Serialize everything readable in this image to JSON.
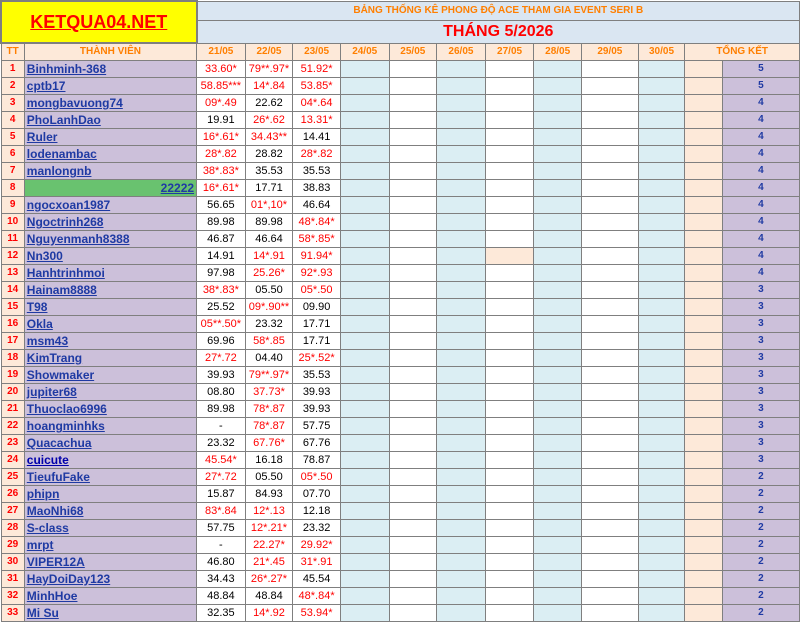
{
  "logo": "KETQUA04.NET",
  "title": "BẢNG THỐNG KÊ PHONG ĐỘ ACE THAM GIA EVENT SERI B",
  "month": "THÁNG 5/2026",
  "headers": {
    "tt": "TT",
    "member": "THÀNH VIÊN",
    "dates": [
      "21/05",
      "22/05",
      "23/05",
      "24/05",
      "25/05",
      "26/05",
      "27/05",
      "28/05",
      "29/05",
      "30/05"
    ],
    "total": "TỔNG KẾT"
  },
  "rows": [
    {
      "tt": "1",
      "name": "Binhminh-368",
      "d21": "33.60*",
      "d22": "79**.97*",
      "d23": "51.92*",
      "total": "5"
    },
    {
      "tt": "2",
      "name": "cptb17",
      "d21": "58.85***",
      "d22": "14*.84",
      "d23": "53.85*",
      "total": "5"
    },
    {
      "tt": "3",
      "name": "mongbavuong74",
      "d21": "09*.49",
      "d22": "22.62",
      "d23": "04*.64",
      "total": "4"
    },
    {
      "tt": "4",
      "name": "PhoLanhDao",
      "d21": "19.91",
      "d22": "26*.62",
      "d23": "13.31*",
      "total": "4"
    },
    {
      "tt": "5",
      "name": "Ruler",
      "d21": "16*.61*",
      "d22": "34.43**",
      "d23": "14.41",
      "total": "4"
    },
    {
      "tt": "6",
      "name": "lodenambac",
      "d21": "28*.82",
      "d22": "28.82",
      "d23": "28*.82",
      "total": "4"
    },
    {
      "tt": "7",
      "name": "manlongnb",
      "d21": "38*.83*",
      "d22": "35.53",
      "d23": "35.53",
      "total": "4"
    },
    {
      "tt": "8",
      "name": "22222",
      "d21": "16*.61*",
      "d22": "17.71",
      "d23": "38.83",
      "total": "4"
    },
    {
      "tt": "9",
      "name": "ngocxoan1987",
      "d21": "56.65",
      "d22": "01*,10*",
      "d23": "46.64",
      "total": "4"
    },
    {
      "tt": "10",
      "name": "Ngoctrinh268",
      "d21": "89.98",
      "d22": "89.98",
      "d23": "48*.84*",
      "total": "4"
    },
    {
      "tt": "11",
      "name": "Nguyenmanh8388",
      "d21": "46.87",
      "d22": "46.64",
      "d23": "58*.85*",
      "total": "4"
    },
    {
      "tt": "12",
      "name": "Nn300",
      "d21": "14.91",
      "d22": "14*.91",
      "d23": "91.94*",
      "total": "4"
    },
    {
      "tt": "13",
      "name": "Hanhtrinhmoi",
      "d21": "97.98",
      "d22": "25.26*",
      "d23": "92*.93",
      "total": "4"
    },
    {
      "tt": "14",
      "name": "Hainam8888",
      "d21": "38*.83*",
      "d22": "05.50",
      "d23": "05*.50",
      "total": "3"
    },
    {
      "tt": "15",
      "name": "T98",
      "d21": "25.52",
      "d22": "09*.90**",
      "d23": "09.90",
      "total": "3"
    },
    {
      "tt": "16",
      "name": "Okla",
      "d21": "05**.50*",
      "d22": "23.32",
      "d23": "17.71",
      "total": "3"
    },
    {
      "tt": "17",
      "name": "msm43",
      "d21": "69.96",
      "d22": "58*.85",
      "d23": "17.71",
      "total": "3"
    },
    {
      "tt": "18",
      "name": "KimTrang",
      "d21": "27*.72",
      "d22": "04.40",
      "d23": "25*.52*",
      "total": "3"
    },
    {
      "tt": "19",
      "name": "Showmaker",
      "d21": "39.93",
      "d22": "79**.97*",
      "d23": "35.53",
      "total": "3"
    },
    {
      "tt": "20",
      "name": "jupiter68",
      "d21": "08.80",
      "d22": "37.73*",
      "d23": "39.93",
      "total": "3"
    },
    {
      "tt": "21",
      "name": "Thuoclao6996",
      "d21": "89.98",
      "d22": "78*.87",
      "d23": "39.93",
      "total": "3"
    },
    {
      "tt": "22",
      "name": "hoangminhks",
      "d21": "-",
      "d22": "78*.87",
      "d23": "57.75",
      "total": "3"
    },
    {
      "tt": "23",
      "name": "Quacachua",
      "d21": "23.32",
      "d22": "67.76*",
      "d23": "67.76",
      "total": "3"
    },
    {
      "tt": "24",
      "name": "cuicute",
      "d21": "45.54*",
      "d22": "16.18",
      "d23": "78.87",
      "total": "3"
    },
    {
      "tt": "25",
      "name": "TieufuFake",
      "d21": "27*.72",
      "d22": "05.50",
      "d23": "05*.50",
      "total": "2"
    },
    {
      "tt": "26",
      "name": "phipn",
      "d21": "15.87",
      "d22": "84.93",
      "d23": "07.70",
      "total": "2"
    },
    {
      "tt": "27",
      "name": "MaoNhi68",
      "d21": "83*.84",
      "d22": "12*.13",
      "d23": "12.18",
      "total": "2"
    },
    {
      "tt": "28",
      "name": "S-class",
      "d21": "57.75",
      "d22": "12*.21*",
      "d23": "23.32",
      "total": "2"
    },
    {
      "tt": "29",
      "name": "mrpt",
      "d21": "-",
      "d22": "22.27*",
      "d23": "29.92*",
      "total": "2"
    },
    {
      "tt": "30",
      "name": "VIPER12A",
      "d21": "46.80",
      "d22": "21*.45",
      "d23": "31*.91",
      "total": "2"
    },
    {
      "tt": "31",
      "name": "HayDoiDay123",
      "d21": "34.43",
      "d22": "26*.27*",
      "d23": "45.54",
      "total": "2"
    },
    {
      "tt": "32",
      "name": "MinhHoe",
      "d21": "48.84",
      "d22": "48.84",
      "d23": "48*.84*",
      "total": "2"
    },
    {
      "tt": "33",
      "name": "Mi Su",
      "d21": "32.35",
      "d22": "14*.92",
      "d23": "53.94*",
      "total": "2"
    }
  ],
  "colors": {
    "accent_red": "#ff0000",
    "orange": "#ff7f00",
    "name_bg": "#ccc0da",
    "highlight_green": "#69c26f"
  }
}
